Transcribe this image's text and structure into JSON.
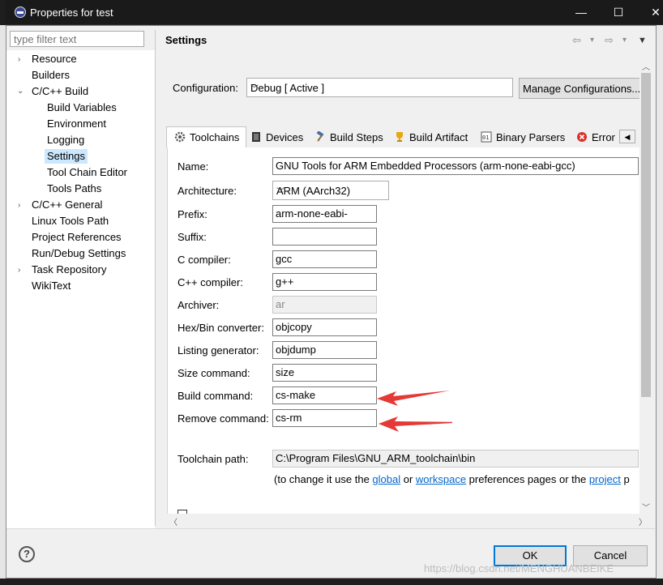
{
  "window": {
    "title": "Properties for test",
    "controls": {
      "minimize": "—",
      "maximize": "☐",
      "close": "✕"
    }
  },
  "sidebar": {
    "filter_placeholder": "type filter text",
    "items": [
      {
        "label": "Resource",
        "expandable": true
      },
      {
        "label": "Builders"
      },
      {
        "label": "C/C++ Build",
        "expanded": true
      },
      {
        "label": "Build Variables"
      },
      {
        "label": "Environment"
      },
      {
        "label": "Logging"
      },
      {
        "label": "Settings",
        "selected": true
      },
      {
        "label": "Tool Chain Editor"
      },
      {
        "label": "Tools Paths"
      },
      {
        "label": "C/C++ General",
        "expandable": true
      },
      {
        "label": "Linux Tools Path"
      },
      {
        "label": "Project References"
      },
      {
        "label": "Run/Debug Settings"
      },
      {
        "label": "Task Repository",
        "expandable": true
      },
      {
        "label": "WikiText"
      }
    ]
  },
  "header": {
    "title": "Settings",
    "back_icon": "⇦",
    "forward_icon": "⇨",
    "dropdown_icon": "▾",
    "menu_icon": "▼"
  },
  "configuration": {
    "label": "Configuration:",
    "value": "Debug  [ Active ]",
    "manage_button": "Manage Configurations..."
  },
  "tabs": [
    {
      "label": "Toolchains",
      "icon": "gear-icon",
      "active": true
    },
    {
      "label": "Devices",
      "icon": "chip-icon"
    },
    {
      "label": "Build Steps",
      "icon": "hammer-icon"
    },
    {
      "label": "Build Artifact",
      "icon": "trophy-icon"
    },
    {
      "label": "Binary Parsers",
      "icon": "binary-icon"
    },
    {
      "label": "Error",
      "icon": "error-icon"
    }
  ],
  "toolchain": {
    "name_label": "Name:",
    "name_value": "GNU Tools for ARM Embedded Processors (arm-none-eabi-gcc)",
    "arch_label": "Architecture:",
    "arch_value": "ARM (AArch32)",
    "prefix_label": "Prefix:",
    "prefix_value": "arm-none-eabi-",
    "suffix_label": "Suffix:",
    "suffix_value": "",
    "c_label": "C compiler:",
    "c_value": "gcc",
    "cpp_label": "C++ compiler:",
    "cpp_value": "g++",
    "archiver_label": "Archiver:",
    "archiver_value": "ar",
    "hexbin_label": "Hex/Bin converter:",
    "hexbin_value": "objcopy",
    "listing_label": "Listing generator:",
    "listing_value": "objdump",
    "size_label": "Size command:",
    "size_value": "size",
    "build_label": "Build command:",
    "build_value": "cs-make",
    "remove_label": "Remove command:",
    "remove_value": "cs-rm",
    "path_label": "Toolchain path:",
    "path_value": "C:\\Program Files\\GNU_ARM_toolchain\\bin",
    "help_pre": "(to change it use the ",
    "help_global": "global",
    "help_or": " or ",
    "help_workspace": "workspace",
    "help_mid": " preferences pages or the ",
    "help_project": "project",
    "help_post": " p"
  },
  "footer": {
    "help_icon": "?",
    "ok": "OK",
    "cancel": "Cancel",
    "watermark": "https://blog.csdn.net/MENGHUANBEIKE"
  },
  "colors": {
    "accent": "#0078d7",
    "selection": "#cce8ff",
    "annotation_arrow": "#e53935"
  }
}
